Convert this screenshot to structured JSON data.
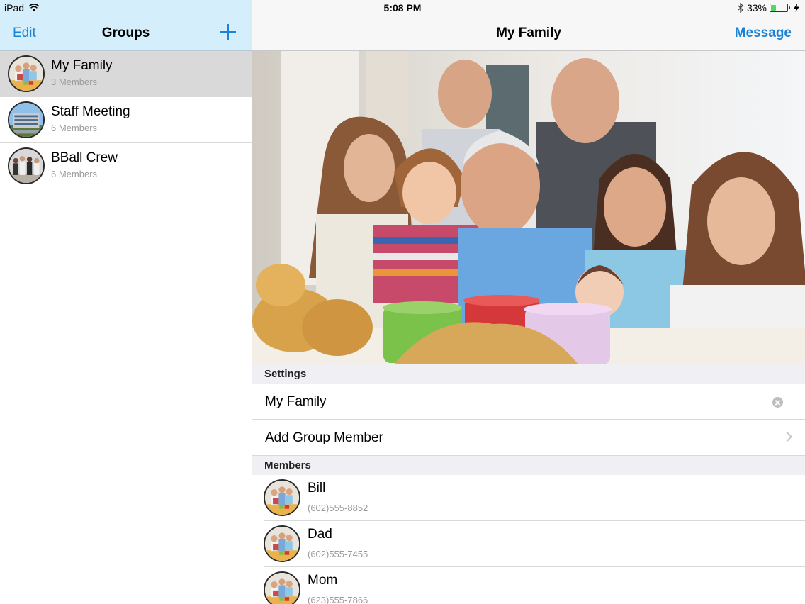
{
  "status_bar": {
    "device": "iPad",
    "time": "5:08 PM",
    "battery_percent": "33%",
    "battery_level": 0.33,
    "icons": [
      "wifi-icon",
      "bluetooth-icon",
      "battery-icon",
      "charging-icon"
    ]
  },
  "left_pane": {
    "edit_label": "Edit",
    "title": "Groups",
    "add_icon": "plus-icon",
    "groups": [
      {
        "name": "My Family",
        "members": "3 Members",
        "selected": true
      },
      {
        "name": "Staff Meeting",
        "members": "6 Members",
        "selected": false
      },
      {
        "name": "BBall Crew",
        "members": "6 Members",
        "selected": false
      }
    ]
  },
  "right_pane": {
    "title": "My Family",
    "message_label": "Message",
    "settings_header": "Settings",
    "group_name_value": "My Family",
    "add_member_label": "Add Group Member",
    "members_header": "Members",
    "members": [
      {
        "name": "Bill",
        "phone": "(602)555-8852"
      },
      {
        "name": "Dad",
        "phone": "(602)555-7455"
      },
      {
        "name": "Mom",
        "phone": "(623)555-7866"
      }
    ]
  },
  "colors": {
    "accent": "#1a82d8",
    "left_header_bg": "#d5eefb",
    "selected_row": "#d9d9d9",
    "section_bg": "#efeff4"
  }
}
